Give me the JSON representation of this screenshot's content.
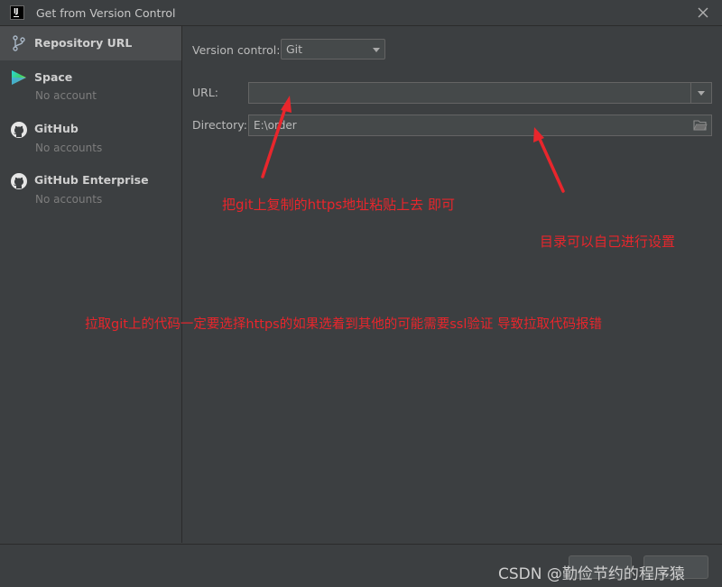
{
  "window": {
    "title": "Get from Version Control",
    "logo_text": "IJ"
  },
  "sidebar": {
    "items": [
      {
        "label": "Repository URL",
        "sub": "",
        "icon": "git-branch-icon",
        "selected": true
      },
      {
        "label": "Space",
        "sub": "No account",
        "icon": "space-icon",
        "selected": false
      },
      {
        "label": "GitHub",
        "sub": "No accounts",
        "icon": "github-icon",
        "selected": false
      },
      {
        "label": "GitHub Enterprise",
        "sub": "No accounts",
        "icon": "github-enterprise-icon",
        "selected": false
      }
    ]
  },
  "form": {
    "vcs_label": "Version control:",
    "vcs_value": "Git",
    "url_label": "URL:",
    "url_value": "",
    "dir_label": "Directory:",
    "dir_value": "E:\\order"
  },
  "annotations": {
    "url_hint": "把git上复制的https地址粘贴上去 即可",
    "dir_hint": "目录可以自己进行设置",
    "note": "拉取git上的代码一定要选择https的如果选着到其他的可能需要ssl验证 导致拉取代码报错"
  },
  "watermark": "CSDN @勤俭节约的程序猿",
  "colors": {
    "background": "#3c3f41",
    "annotation_red": "#e8262c",
    "text": "#bbbbbb"
  }
}
